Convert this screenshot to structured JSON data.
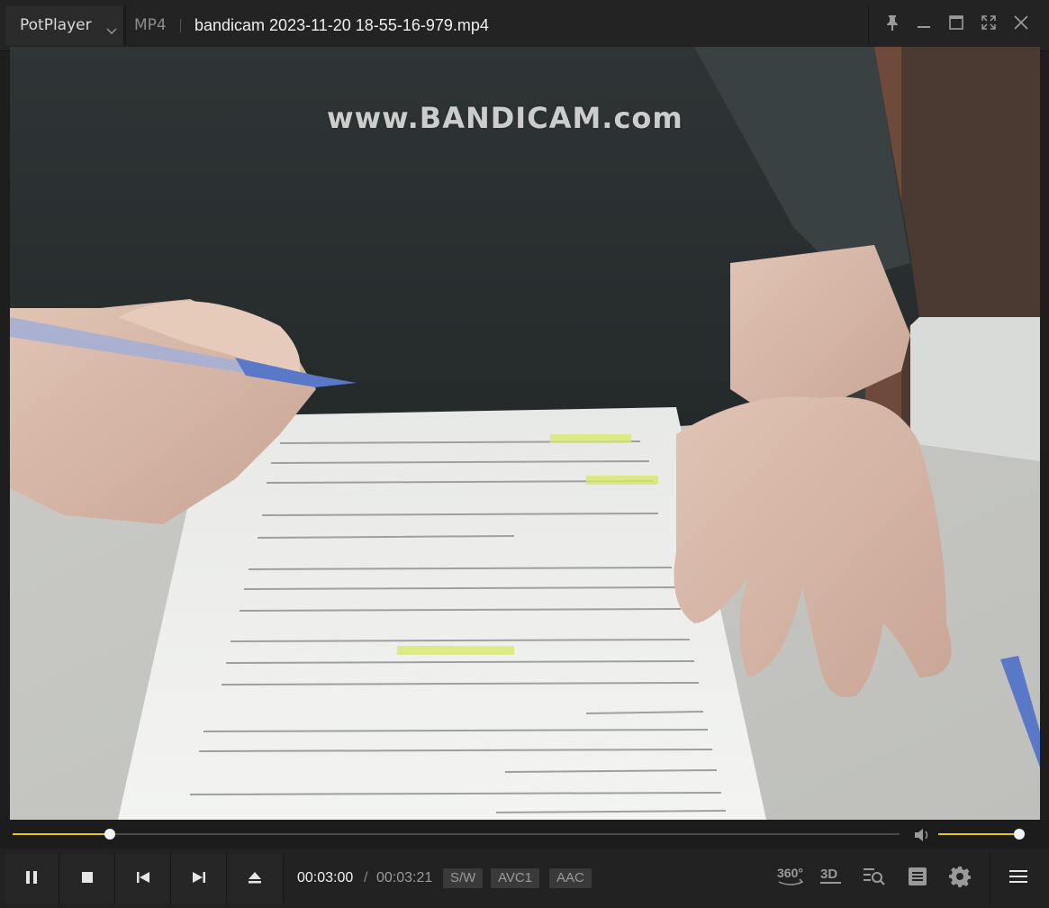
{
  "app": {
    "name": "PotPlayer",
    "format": "MP4",
    "file_title": "bandicam 2023-11-20 18-55-16-979.mp4"
  },
  "video": {
    "watermark": "www.BANDICAM.com"
  },
  "playback": {
    "current_time": "00:03:00",
    "separator": "/",
    "total_time": "00:03:21",
    "progress": 0.11,
    "volume": 0.95
  },
  "badges": {
    "decoder": "S/W",
    "video_codec": "AVC1",
    "audio_codec": "AAC"
  },
  "icons": {
    "labels": {
      "vr": "360°",
      "stereo": "3D"
    }
  },
  "colors": {
    "accent": "#e8c21a",
    "background": "#1e1e1e"
  }
}
